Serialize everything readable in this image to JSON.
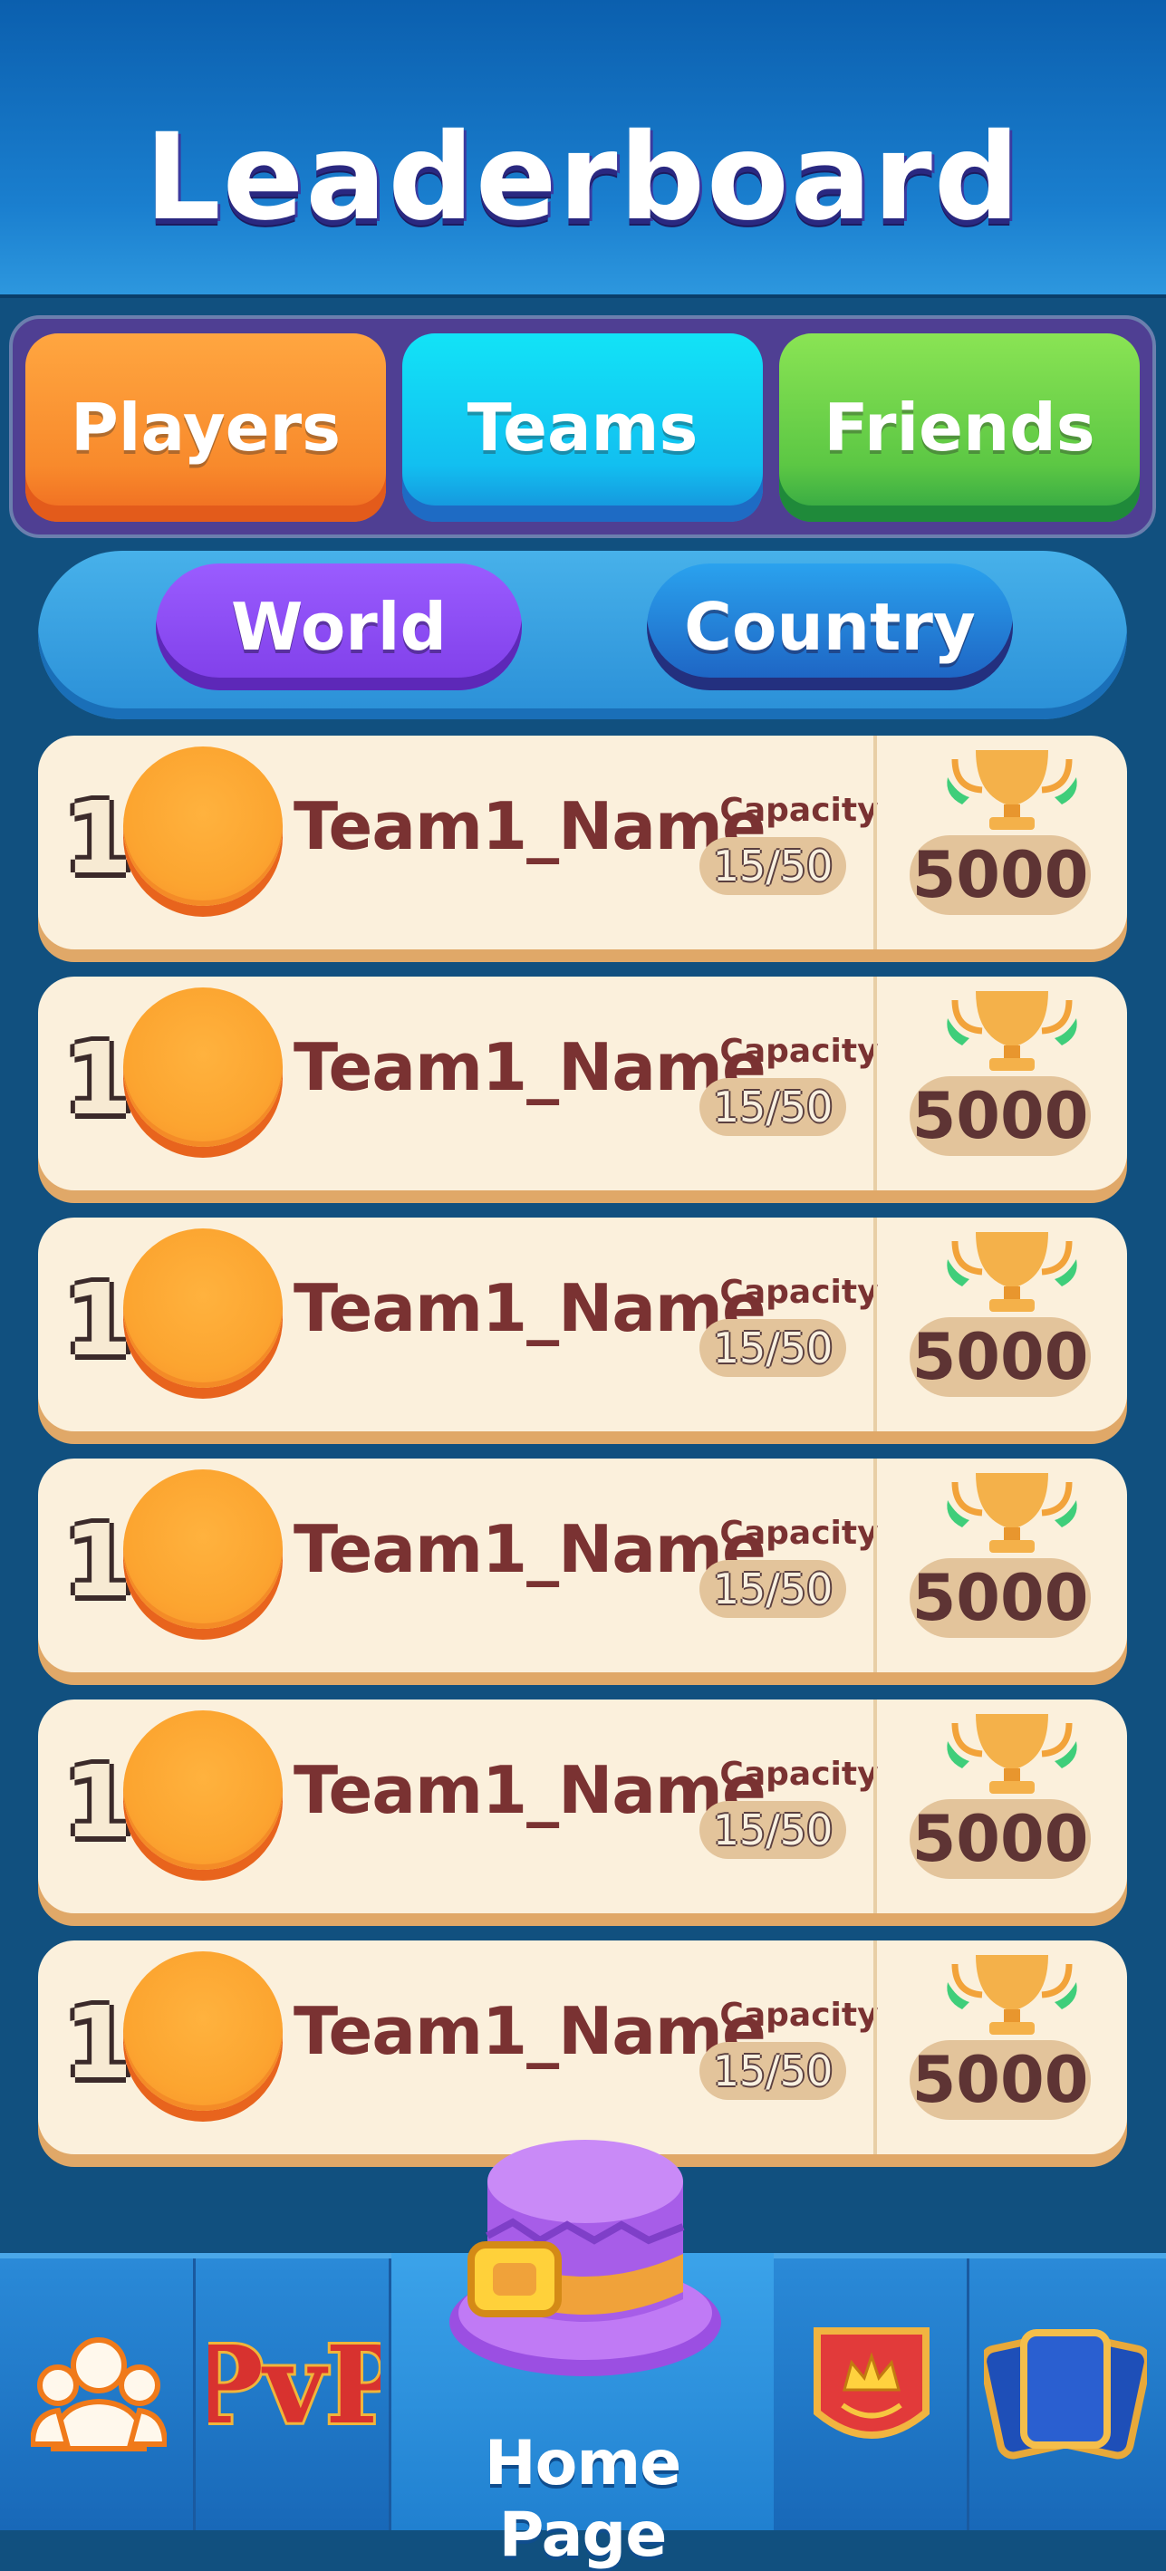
{
  "header": {
    "title": "Leaderboard"
  },
  "tabs": [
    {
      "label": "Players"
    },
    {
      "label": "Teams"
    },
    {
      "label": "Friends"
    }
  ],
  "region": {
    "world": "World",
    "country": "Country"
  },
  "rows": [
    {
      "rank": "1",
      "name": "Team1_Name",
      "capacity_label": "Capacity",
      "capacity": "15/50",
      "score": "5000"
    },
    {
      "rank": "1",
      "name": "Team1_Name",
      "capacity_label": "Capacity",
      "capacity": "15/50",
      "score": "5000"
    },
    {
      "rank": "1",
      "name": "Team1_Name",
      "capacity_label": "Capacity",
      "capacity": "15/50",
      "score": "5000"
    },
    {
      "rank": "1",
      "name": "Team1_Name",
      "capacity_label": "Capacity",
      "capacity": "15/50",
      "score": "5000"
    },
    {
      "rank": "1",
      "name": "Team1_Name",
      "capacity_label": "Capacity",
      "capacity": "15/50",
      "score": "5000"
    },
    {
      "rank": "1",
      "name": "Team1_Name",
      "capacity_label": "Capacity",
      "capacity": "15/50",
      "score": "5000"
    }
  ],
  "bottom_nav": {
    "items": [
      {
        "icon": "users-icon"
      },
      {
        "icon": "pvp-icon",
        "text": "PvP"
      },
      {
        "icon": "top-hat-icon",
        "label": "Home Page"
      },
      {
        "icon": "crown-shield-icon"
      },
      {
        "icon": "cards-icon"
      }
    ]
  },
  "colors": {
    "players_tab": "#f88a2c",
    "teams_tab": "#12bff0",
    "friends_tab": "#5cc744",
    "world_pill": "#8a45f0",
    "country_pill": "#1d6fd0",
    "row_bg": "#fbf0dc",
    "team_name": "#7a3232"
  }
}
